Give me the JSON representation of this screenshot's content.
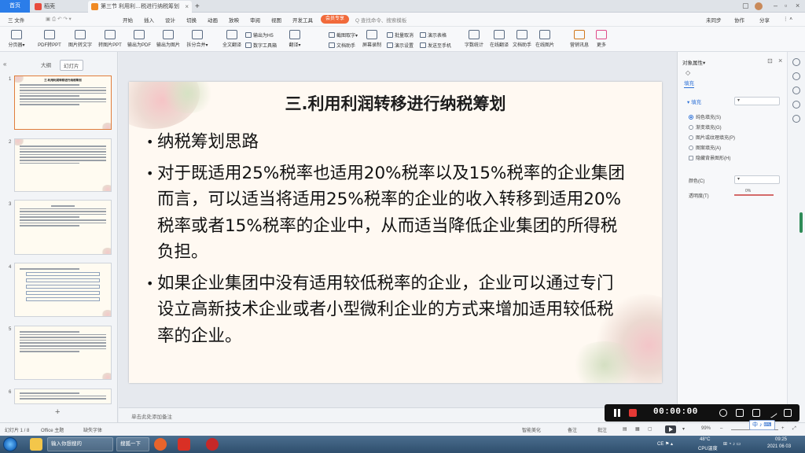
{
  "tabs": {
    "home": "首页",
    "doc2": "稻壳",
    "active": "第三节 利用利…税进行纳税筹划",
    "add": "+"
  },
  "menu": {
    "file": "三 文件",
    "items": [
      "开始",
      "插入",
      "设计",
      "切换",
      "动画",
      "放映",
      "审阅",
      "视图",
      "开发工具"
    ],
    "member": "会员专享",
    "search": "Q 查找命令、搜索模板",
    "right": [
      "未同步",
      "协作",
      "分享"
    ]
  },
  "ribbon": {
    "big": [
      "分页器▾",
      "PDF转PPT",
      "图片转文字",
      "转图片PPT",
      "输出为PDF",
      "输出为图片",
      "拆分合并▾",
      "全文翻译",
      "翻译▾",
      "文档助手",
      "屏幕录制",
      "截图取字▾",
      "在线翻译",
      "字数统计",
      "在线图片",
      "营销讯息",
      "更多"
    ],
    "small": [
      "输出为H5",
      "数字工具箱",
      "截图取字▾",
      "文档助手",
      "批量取消",
      "演示设置",
      "发送至手机",
      "演示表格"
    ]
  },
  "left_panel": {
    "tabs": [
      "大纲",
      "幻灯片"
    ],
    "slide_numbers": [
      "1",
      "2",
      "3",
      "4",
      "5",
      "6"
    ],
    "add": "+"
  },
  "slide": {
    "title": "三.利用利润转移进行纳税筹划",
    "bullets": [
      "纳税筹划思路",
      "对于既适用25%税率也适用20%税率以及15%税率的企业集团而言，可以适当将适用25%税率的企业的收入转移到适用20%税率或者15%税率的企业中，从而适当降低企业集团的所得税负担。",
      "如果企业集团中没有适用较低税率的企业，企业可以通过专门设立高新技术企业或者小型微利企业的方式来增加适用较低税率的企业。"
    ]
  },
  "notes": "单击此处添加备注",
  "right_pane": {
    "title": "对象属性▾",
    "tab": "填充",
    "section": "▾ 填充",
    "options": [
      "纯色填充(S)",
      "渐变填充(G)",
      "图片或纹理填充(P)",
      "图案填充(A)",
      "隐藏背景图形(H)"
    ],
    "color_label": "颜色(C)",
    "transparency_label": "透明度(T)",
    "transparency_value": "0%"
  },
  "recorder": {
    "time": "00:00:00"
  },
  "status": {
    "slide_counter": "幻灯片 1 / 8",
    "theme": "Office 主题",
    "font": "缺失字体",
    "beautify": "智能美化",
    "notes": "备注",
    "comments": "批注",
    "zoom": "99%"
  },
  "ime": "中",
  "taskbar": {
    "items": [
      "输入你想搜的",
      "搜狐一下"
    ],
    "temp": "48°C",
    "cpu": "CPU温度",
    "time": "09:25",
    "date": "2021 06 03"
  },
  "colors": {
    "accent": "#2b7de9",
    "member": "#f16a3b",
    "record_stop": "#e53935"
  }
}
